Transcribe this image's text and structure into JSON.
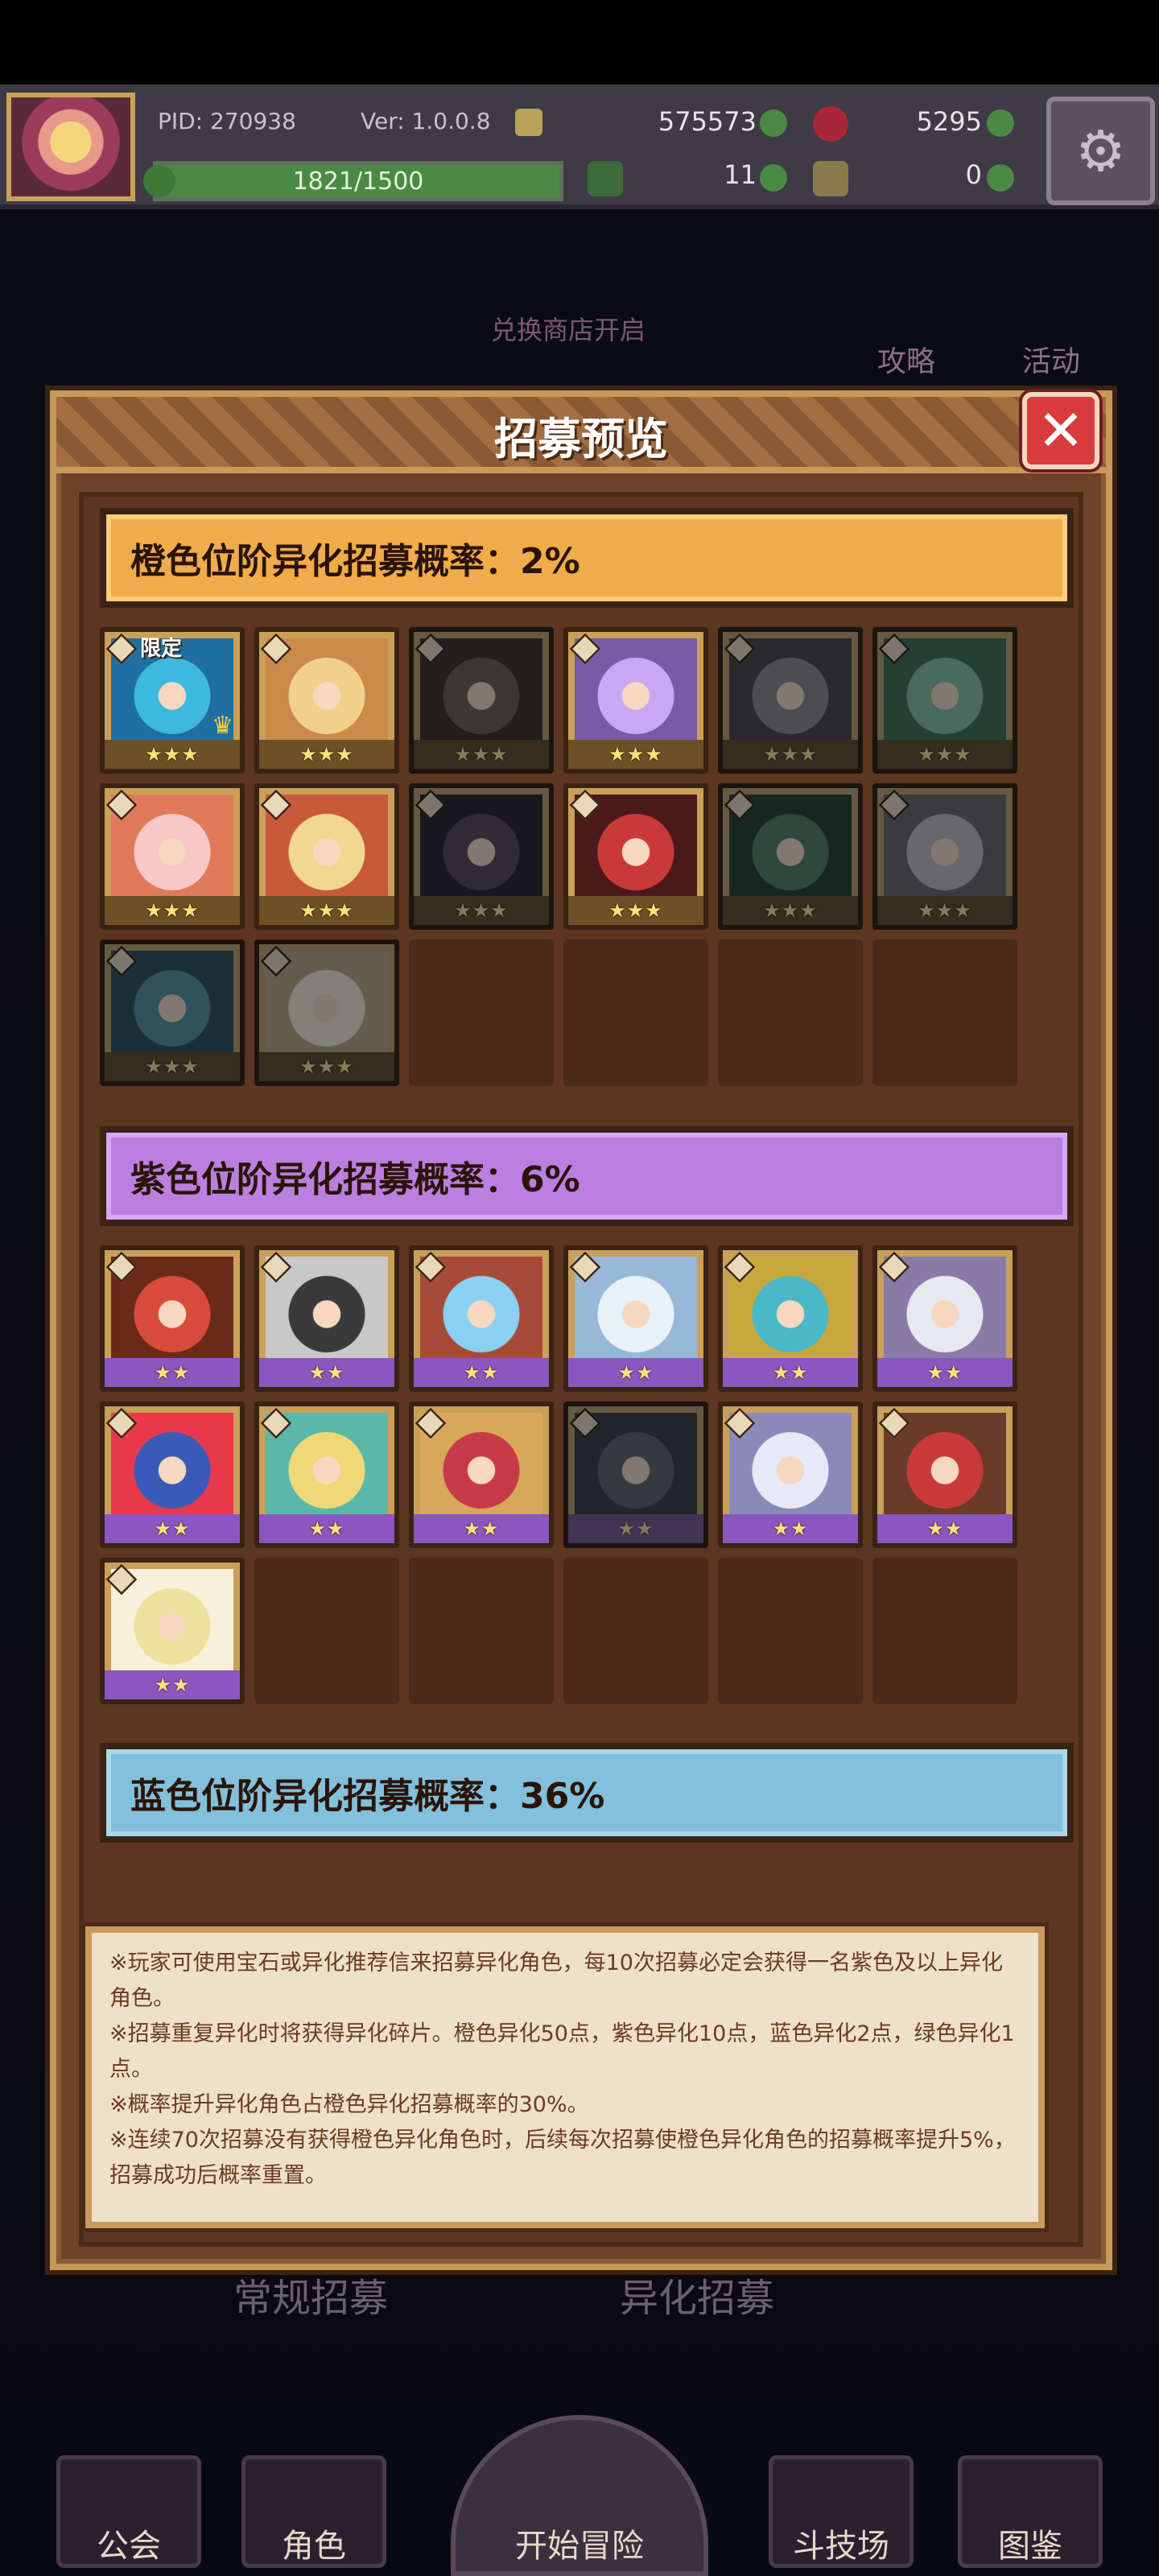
{
  "top_bar": {
    "pid_label": "PID: 270938",
    "version": "Ver: 1.0.0.8",
    "coins": "575573",
    "gems": "5295",
    "exp_text": "1821/1500",
    "clover_count": "11",
    "key_count": "0"
  },
  "background": {
    "shop_banner": "兑换商店开启",
    "guide_label": "攻略",
    "event_label": "活动",
    "normal_recruit": "常规招募",
    "variant_recruit": "异化招募"
  },
  "bottom_nav": {
    "guild": "公会",
    "character": "角色",
    "adventure": "开始冒险",
    "arena": "斗技场",
    "codex": "图鉴"
  },
  "modal": {
    "title": "招募预览",
    "close_icon": "close-icon",
    "orange_tier": {
      "label": "橙色位阶异化招募概率：2%",
      "stars": "★★★",
      "limited_badge": "限定",
      "card_count": 14
    },
    "purple_tier": {
      "label": "紫色位阶异化招募概率：6%",
      "stars": "★★",
      "card_count": 13
    },
    "blue_tier": {
      "label": "蓝色位阶异化招募概率：36%"
    },
    "notes": [
      "※玩家可使用宝石或异化推荐信来招募异化角色，每10次招募必定会获得一名紫色及以上异化角色。",
      "※招募重复异化时将获得异化碎片。橙色异化50点，紫色异化10点，蓝色异化2点，绿色异化1点。",
      "※概率提升异化角色占橙色异化招募概率的30%。",
      "※连续70次招募没有获得橙色异化角色时，后续每次招募使橙色异化角色的招募概率提升5%，招募成功后概率重置。"
    ]
  },
  "colors": {
    "orange_tier": "#f0ac4a",
    "purple_tier": "#bb7fe0",
    "blue_tier": "#82c0db",
    "modal_bg": "#6e4329",
    "close_button": "#d83c3c"
  }
}
